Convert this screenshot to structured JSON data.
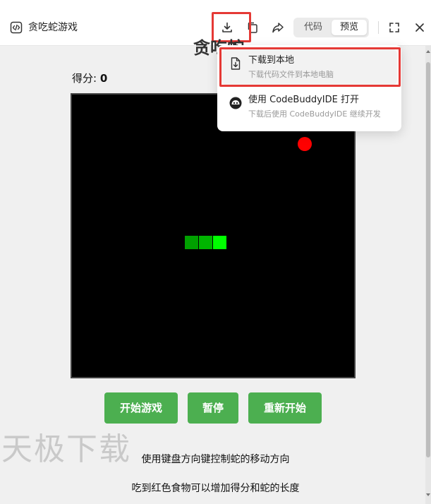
{
  "window": {
    "title": "贪吃蛇游戏"
  },
  "toolbar": {
    "download_icon": "download-icon",
    "copy_icon": "copy-icon",
    "share_icon": "share-icon",
    "tab_code": "代码",
    "tab_preview": "预览",
    "active_tab": "预览",
    "fullscreen_icon": "fullscreen-icon",
    "close_icon": "close-icon"
  },
  "game": {
    "title": "贪吃蛇",
    "score_label": "得分: ",
    "score_value": "0",
    "grid_size": 20,
    "food": {
      "col": 16,
      "row": 3,
      "color": "#ff0000"
    },
    "snake": [
      {
        "col": 8,
        "row": 10,
        "color": "#00a000"
      },
      {
        "col": 9,
        "row": 10,
        "color": "#00b400"
      },
      {
        "col": 10,
        "row": 10,
        "color": "#00ff00"
      }
    ]
  },
  "buttons": {
    "start": "开始游戏",
    "pause": "暂停",
    "restart": "重新开始",
    "color": "#4caf50"
  },
  "instructions": [
    "使用键盘方向键控制蛇的移动方向",
    "吃到红色食物可以增加得分和蛇的长度"
  ],
  "watermark": "天极下载",
  "dropdown": {
    "items": [
      {
        "label": "下载到本地",
        "sub": "下载代码文件到本地电脑",
        "icon": "file-download-icon"
      },
      {
        "label": "使用 CodeBuddyIDE 打开",
        "sub": "下载后使用 CodeBuddyIDE 继续开发",
        "icon": "codebuddy-icon"
      }
    ]
  },
  "colors": {
    "highlight": "#e53935",
    "board": "#000000"
  }
}
